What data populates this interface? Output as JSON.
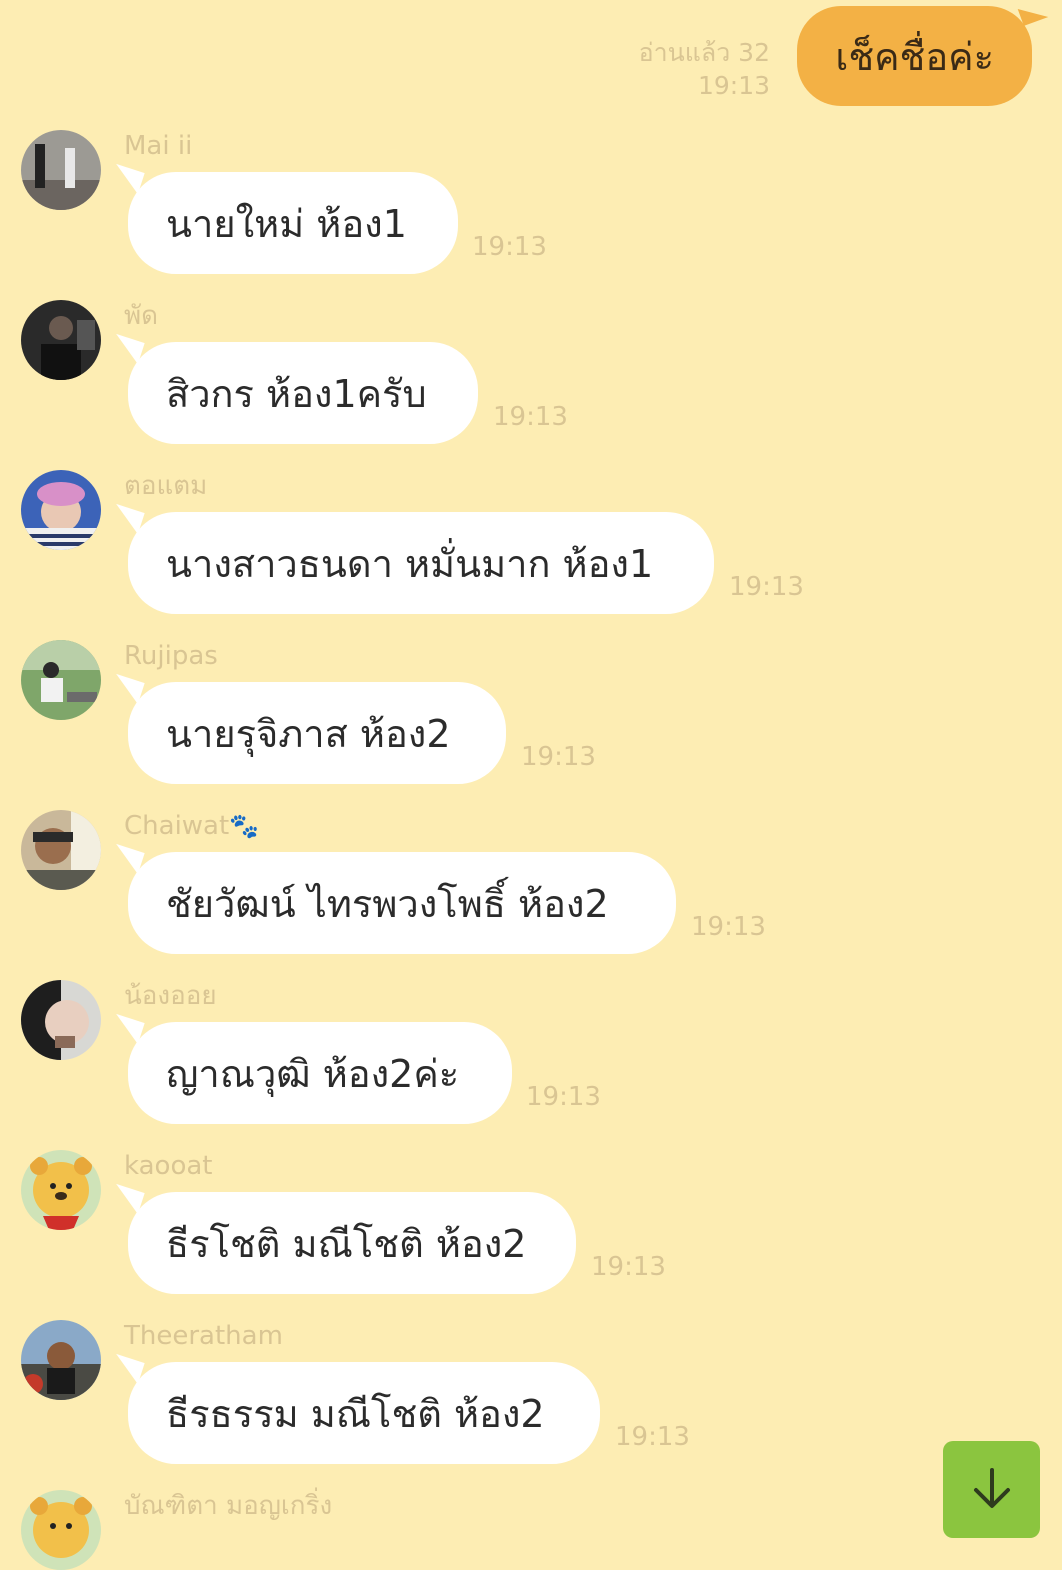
{
  "sent": {
    "text": "เช็คชื่อค่ะ",
    "read": "อ่านแล้ว 32",
    "time": "19:13"
  },
  "messages": [
    {
      "sender": "Mai ii",
      "text": "นายใหม่ ห้อง1",
      "time": "19:13"
    },
    {
      "sender": "พัด",
      "text": "สิวกร ห้อง1ครับ",
      "time": "19:13"
    },
    {
      "sender": "ตอแตม",
      "text": "นางสาวธนดา หมั่นมาก ห้อง1",
      "time": "19:13"
    },
    {
      "sender": "Rujipas",
      "text": "นายรุจิภาส ห้อง2",
      "time": "19:13"
    },
    {
      "sender": "Chaiwat",
      "sender_emoji": "🐾",
      "text": "ชัยวัฒน์ ไทรพวงโพธิ์ ห้อง2",
      "time": "19:13"
    },
    {
      "sender": "น้องออย",
      "text": "ญาณวุฒิ ห้อง2ค่ะ",
      "time": "19:13"
    },
    {
      "sender": "kaooat",
      "text": "ธีรโชติ มณีโชติ ห้อง2",
      "time": "19:13"
    },
    {
      "sender": "Theeratham",
      "text": "ธีรธรรม มณีโชติ ห้อง2",
      "time": "19:13"
    },
    {
      "sender": "บัณฑิตา มอญเกริ่ง"
    }
  ],
  "colors": {
    "background": "#FDEDB3",
    "sent_bubble": "#F3B145",
    "received_bubble": "#FFFFFF",
    "meta_text": "#D9C593",
    "scroll_button": "#8BC53F"
  },
  "icons": {
    "scroll_button": "arrow-down-icon"
  }
}
